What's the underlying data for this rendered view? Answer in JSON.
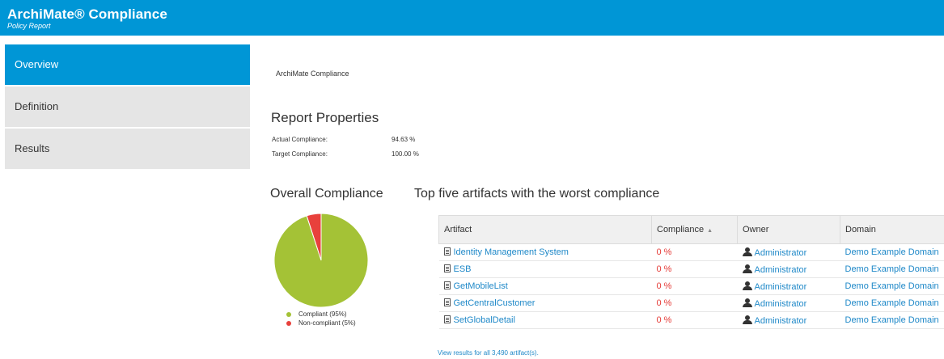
{
  "header": {
    "title": "ArchiMate® Compliance",
    "subtitle": "Policy Report"
  },
  "sidebar": {
    "items": [
      {
        "label": "Overview",
        "active": true
      },
      {
        "label": "Definition",
        "active": false
      },
      {
        "label": "Results",
        "active": false
      }
    ]
  },
  "breadcrumb": "ArchiMate Compliance",
  "report_properties": {
    "heading": "Report Properties",
    "actual_label": "Actual Compliance:",
    "actual_value": "94.63 %",
    "target_label": "Target Compliance:",
    "target_value": "100.00 %"
  },
  "overall": {
    "heading": "Overall Compliance",
    "legend": [
      {
        "label": "Compliant (95%)",
        "color": "#a4c236"
      },
      {
        "label": "Non-compliant (5%)",
        "color": "#e8413c"
      }
    ]
  },
  "chart_data": {
    "type": "pie",
    "title": "",
    "slices": [
      {
        "name": "Compliant (95%)",
        "value": 95,
        "color": "#a4c236"
      },
      {
        "name": "Non-compliant (5%)",
        "value": 5,
        "color": "#e8413c"
      }
    ]
  },
  "top_five": {
    "heading": "Top five artifacts with the worst compliance",
    "columns": [
      "Artifact",
      "Compliance",
      "Owner",
      "Domain"
    ],
    "sort_icon": "sort-ascending-icon",
    "rows": [
      {
        "artifact": "Identity Management System",
        "compliance": "0 %",
        "owner": "Administrator",
        "domain": "Demo Example Domain"
      },
      {
        "artifact": "ESB",
        "compliance": "0 %",
        "owner": "Administrator",
        "domain": "Demo Example Domain"
      },
      {
        "artifact": "GetMobileList",
        "compliance": "0 %",
        "owner": "Administrator",
        "domain": "Demo Example Domain"
      },
      {
        "artifact": "GetCentralCustomer",
        "compliance": "0 %",
        "owner": "Administrator",
        "domain": "Demo Example Domain"
      },
      {
        "artifact": "SetGlobalDetail",
        "compliance": "0 %",
        "owner": "Administrator",
        "domain": "Demo Example Domain"
      }
    ],
    "view_all": "View results for all 3,490 artifact(s)."
  },
  "colors": {
    "brand": "#0096d6",
    "link": "#1e88c8",
    "bad": "#e53935"
  }
}
